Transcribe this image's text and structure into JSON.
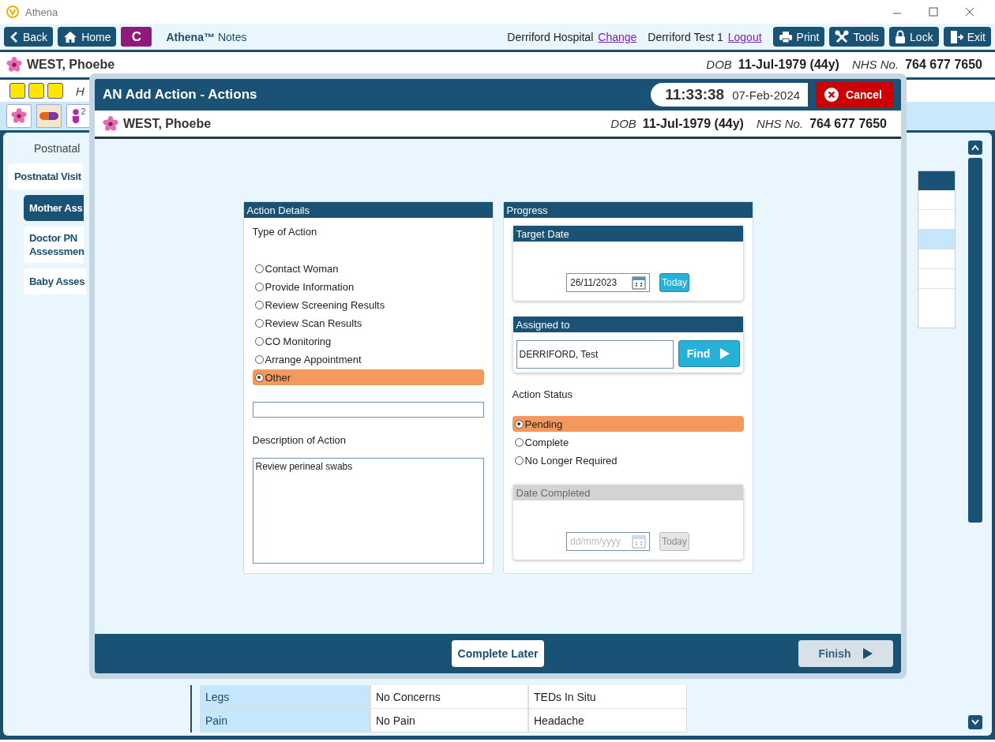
{
  "window": {
    "title": "Athena"
  },
  "toolbar": {
    "nav_buttons": [
      "Back",
      "Home"
    ],
    "app_badge": "C",
    "app_name": "Athena™",
    "app_subtitle": "Notes",
    "hospital": "Derriford Hospital",
    "change_link": "Change",
    "user": "Derriford Test 1",
    "logout_link": "Logout",
    "action_buttons": [
      "Print",
      "Tools",
      "Lock",
      "Exit"
    ]
  },
  "patient": {
    "name": "WEST, Phoebe",
    "dob_label": "DOB",
    "dob": "11-Jul-1979 (44y)",
    "nhs_label": "NHS No.",
    "nhs": "764 677 7650"
  },
  "alert_row": {
    "text": "H"
  },
  "icon_row": {
    "count": "2"
  },
  "sidebar": {
    "heading": "Postnatal",
    "items": [
      {
        "label": "Postnatal Visit",
        "selected": false,
        "children": [
          {
            "label": "Mother Ass",
            "selected": true
          },
          {
            "label": "Doctor PN Assessmen",
            "selected": false
          },
          {
            "label": "Baby Asses",
            "selected": false
          }
        ]
      }
    ]
  },
  "bottom_table": {
    "rows": [
      [
        "Legs",
        "No Concerns",
        "TEDs In Situ"
      ],
      [
        "Pain",
        "No Pain",
        "Headache"
      ]
    ]
  },
  "dialog": {
    "title": "AN Add Action - Actions",
    "time": "11:33:38",
    "date": "07-Feb-2024",
    "cancel": "Cancel",
    "patient": {
      "name": "WEST, Phoebe",
      "dob_label": "DOB",
      "dob": "11-Jul-1979 (44y)",
      "nhs_label": "NHS No.",
      "nhs": "764 677 7650"
    },
    "action_details": {
      "title": "Action Details",
      "type_label": "Type of Action",
      "types": [
        {
          "label": "Contact Woman",
          "selected": false
        },
        {
          "label": "Provide Information",
          "selected": false
        },
        {
          "label": "Review Screening Results",
          "selected": false
        },
        {
          "label": "Review Scan Results",
          "selected": false
        },
        {
          "label": "CO Monitoring",
          "selected": false
        },
        {
          "label": "Arrange Appointment",
          "selected": false
        },
        {
          "label": "Other",
          "selected": true
        }
      ],
      "description_label": "Description of Action",
      "description": "Review perineal swabs"
    },
    "progress": {
      "title": "Progress",
      "target_date": {
        "title": "Target Date",
        "value": "26/11/2023",
        "today": "Today",
        "disabled": false
      },
      "assigned": {
        "title": "Assigned to",
        "value": "DERRIFORD, Test",
        "find": "Find"
      },
      "status_label": "Action Status",
      "statuses": [
        {
          "label": "Pending",
          "selected": true
        },
        {
          "label": "Complete",
          "selected": false
        },
        {
          "label": "No Longer Required",
          "selected": false
        }
      ],
      "date_completed": {
        "title": "Date Completed",
        "placeholder": "dd/mm/yyyy",
        "today": "Today",
        "disabled": true
      }
    },
    "footer": {
      "complete_later": "Complete Later",
      "finish": {
        "label": "Finish",
        "disabled": true
      }
    }
  }
}
